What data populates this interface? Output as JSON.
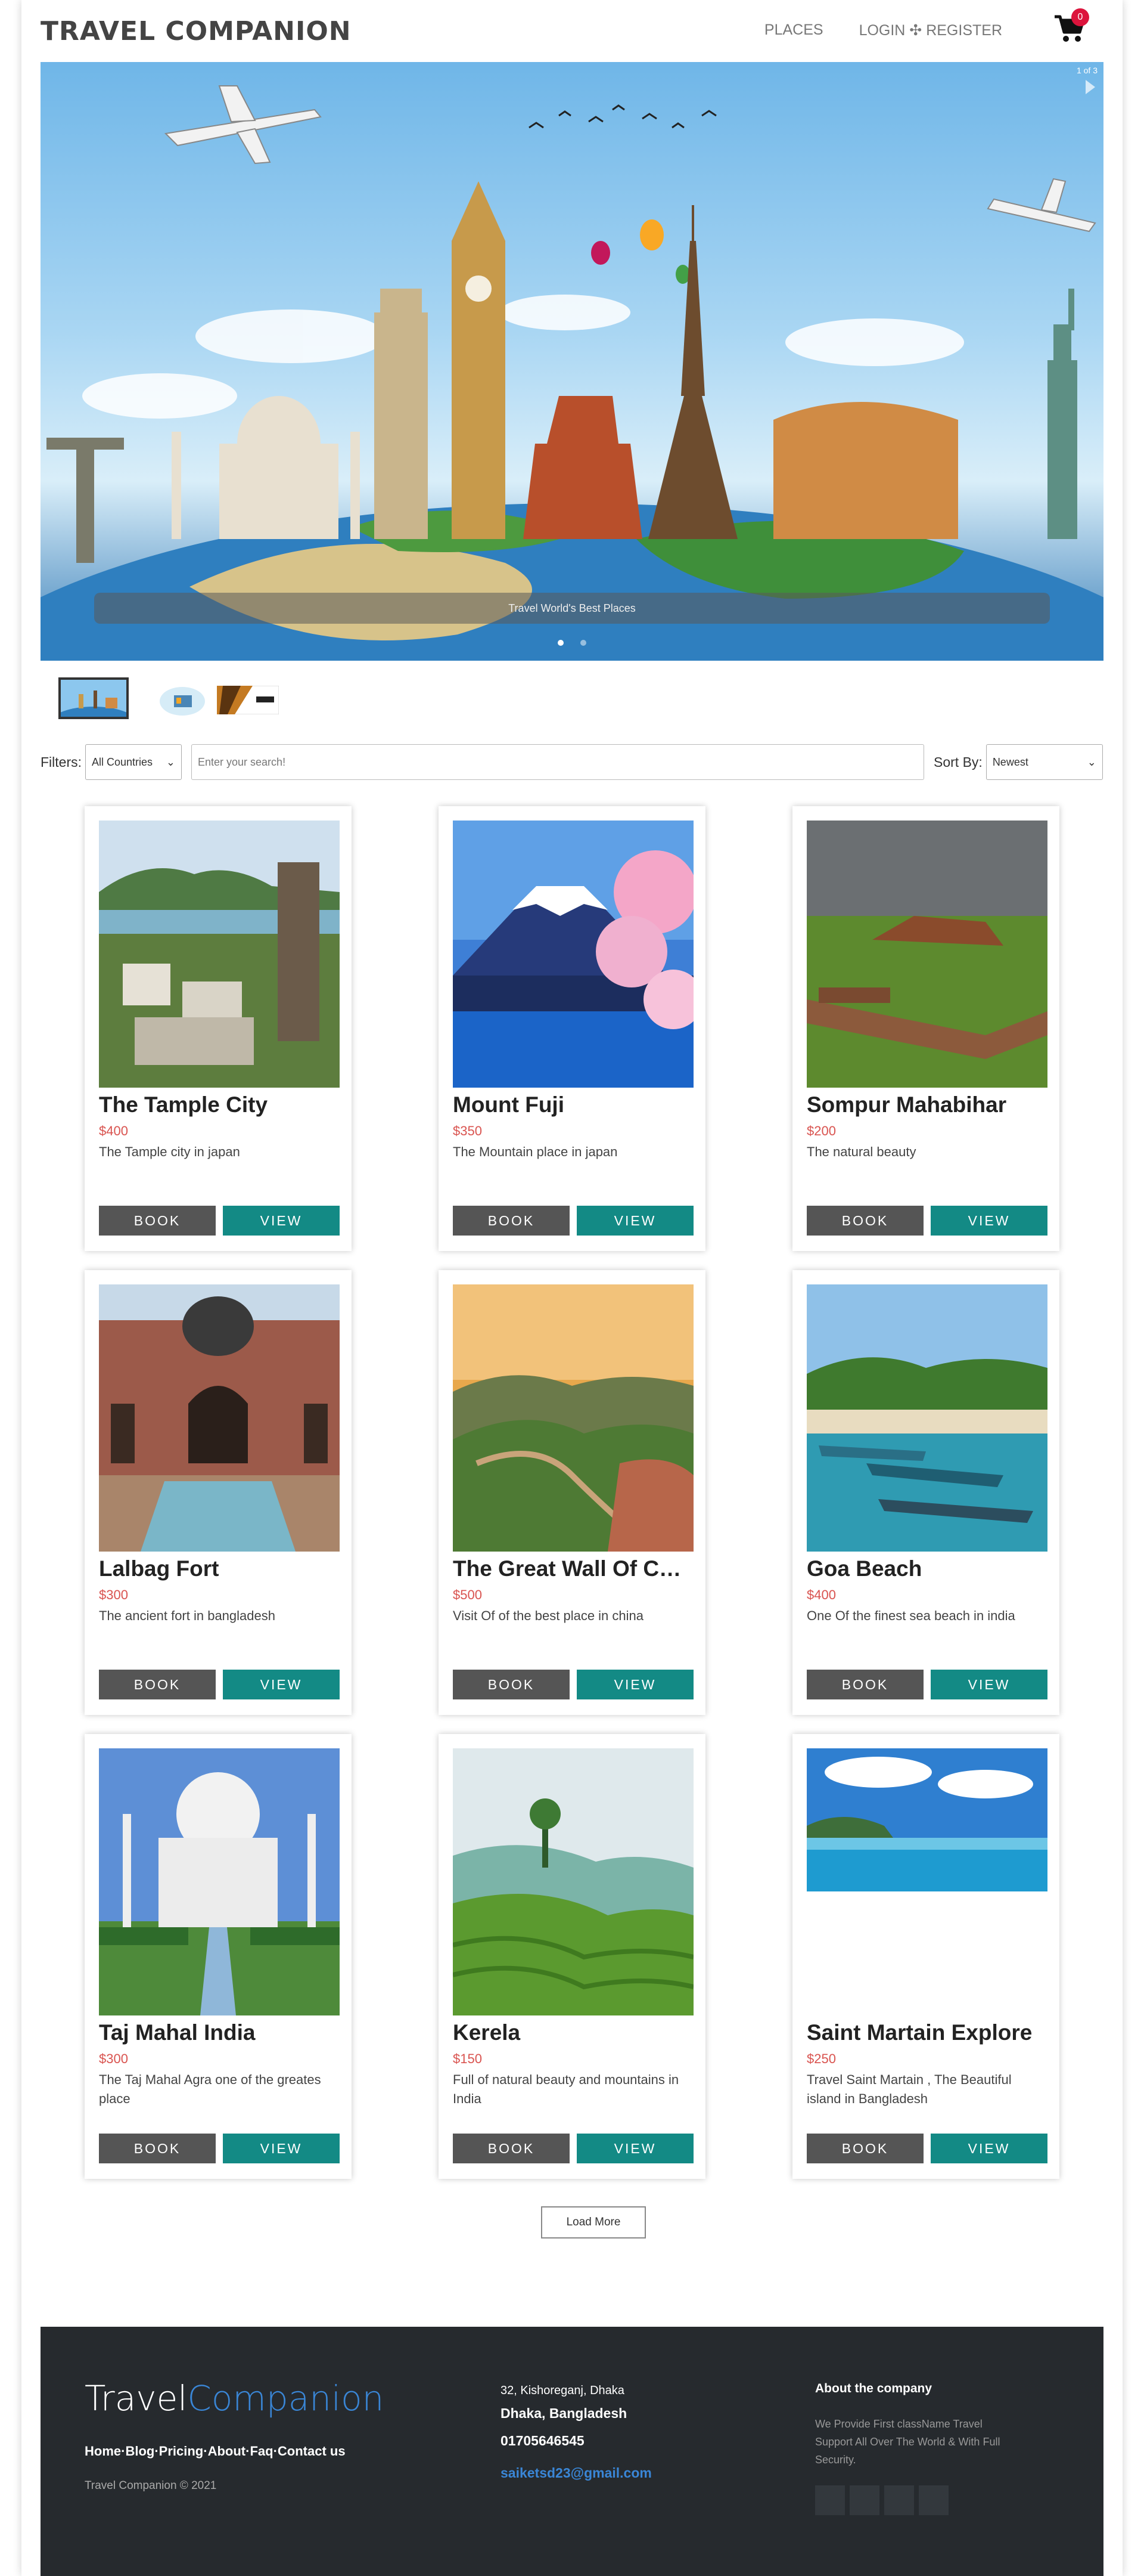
{
  "header": {
    "brand": "TRAVEL COMPANION",
    "nav": [
      "PLACES",
      "LOGIN ✣ REGISTER"
    ],
    "cart_count": "0"
  },
  "hero": {
    "counter": "1 of 3",
    "caption": "Travel World's Best Places",
    "dots": 2,
    "active_dot": 0
  },
  "filters": {
    "label": "Filters:",
    "country": "All Countries",
    "search_placeholder": "Enter your search!",
    "sort_label": "Sort By:",
    "sort_value": "Newest"
  },
  "buttons": {
    "book": "BOOK",
    "view": "VIEW"
  },
  "places": [
    {
      "title": "The Tample City",
      "price": "$400",
      "desc": "The Tample city in japan",
      "scene": "temple"
    },
    {
      "title": "Mount Fuji",
      "price": "$350",
      "desc": "The Mountain place in japan",
      "scene": "fuji"
    },
    {
      "title": "Sompur Mahabihar",
      "price": "$200",
      "desc": "The natural beauty",
      "scene": "ruins"
    },
    {
      "title": "Lalbag Fort",
      "price": "$300",
      "desc": "The ancient fort in bangladesh",
      "scene": "fort"
    },
    {
      "title": "The Great Wall Of China",
      "price": "$500",
      "desc": "Visit Of of the best place in china",
      "scene": "wall"
    },
    {
      "title": "Goa Beach",
      "price": "$400",
      "desc": "One Of the finest sea beach in india",
      "scene": "beach"
    },
    {
      "title": "Taj Mahal India",
      "price": "$300",
      "desc": "The Taj Mahal Agra one of the greates place",
      "scene": "taj"
    },
    {
      "title": "Kerela",
      "price": "$150",
      "desc": "Full of natural beauty and mountains in India",
      "scene": "tea"
    },
    {
      "title": "Saint Martain Explore",
      "price": "$250",
      "desc": "Travel Saint Martain , The Beautiful island in Bangladesh",
      "scene": "island"
    }
  ],
  "load_more": "Load More",
  "footer": {
    "logo_part1": "Travel",
    "logo_part2": "Companion",
    "links": [
      "Home",
      "Blog",
      "Pricing",
      "About",
      "Faq",
      "Contact us"
    ],
    "copyright": "Travel Companion © 2021",
    "address_line1": "32, Kishoreganj, Dhaka",
    "address_line2": "Dhaka, Bangladesh",
    "phone": "01705646545",
    "email": "saiketsd23@gmail.com",
    "about_heading": "About the company",
    "about_text": "We Provide First className Travel Support All Over The World & With Full Security."
  }
}
